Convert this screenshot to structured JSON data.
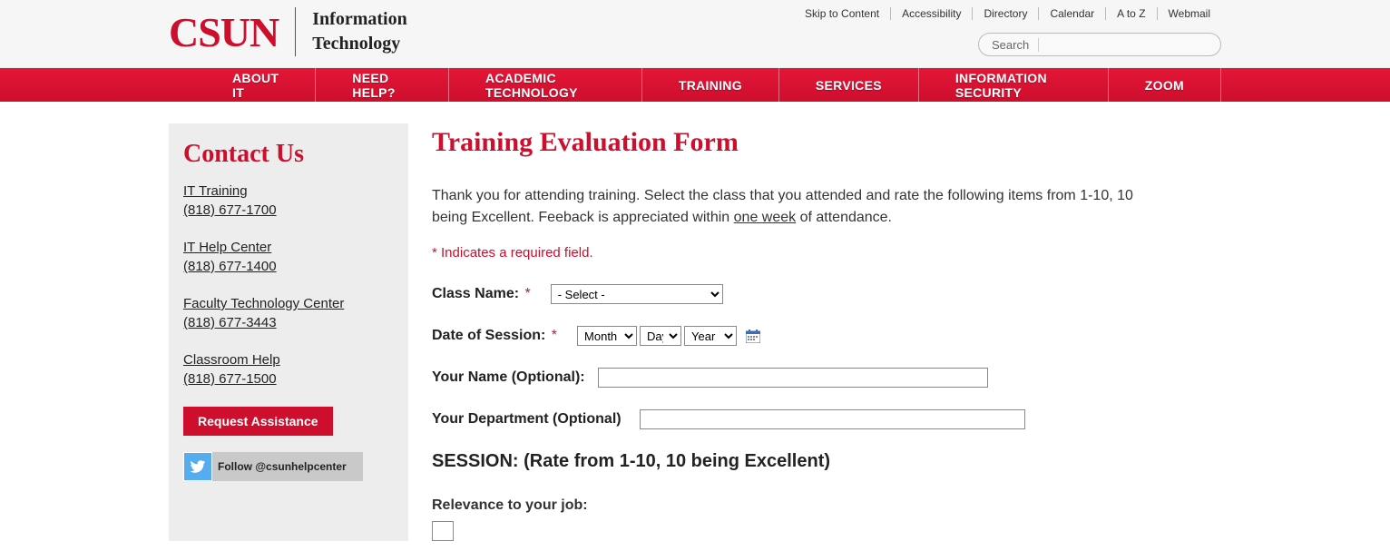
{
  "header": {
    "logo_text": "CSUN",
    "site_title_line1": "Information",
    "site_title_line2": "Technology",
    "util_links": [
      "Skip to Content",
      "Accessibility",
      "Directory",
      "Calendar",
      "A to Z",
      "Webmail"
    ],
    "search_label": "Search"
  },
  "nav": {
    "items": [
      "ABOUT IT",
      "NEED HELP?",
      "ACADEMIC TECHNOLOGY",
      "TRAINING",
      "SERVICES",
      "INFORMATION SECURITY",
      "ZOOM"
    ]
  },
  "sidebar": {
    "title": "Contact Us",
    "contacts": [
      {
        "name": "IT Training",
        "phone": "(818) 677-1700"
      },
      {
        "name": "IT Help Center",
        "phone": "(818) 677-1400"
      },
      {
        "name": "Faculty Technology Center",
        "phone": "(818) 677-3443"
      },
      {
        "name": "Classroom Help",
        "phone": "(818) 677-1500"
      }
    ],
    "request_label": "Request Assistance",
    "twitter_label": "Follow @csunhelpcenter"
  },
  "main": {
    "title": "Training Evaluation Form",
    "intro_pre": "Thank you for attending training. Select the class that you attended and rate the following items from 1-10, 10 being Excellent. Feeback is appreciated within ",
    "intro_underlined": "one week",
    "intro_post": " of attendance.",
    "required_note": "* Indicates a required field.",
    "labels": {
      "class_name": "Class Name:",
      "date_of_session": "Date of Session:",
      "your_name": "Your Name (Optional):",
      "your_department": "Your Department (Optional)"
    },
    "class_select_placeholder": "- Select -",
    "month_placeholder": "Month",
    "day_placeholder": "Day",
    "year_placeholder": "Year",
    "session_heading": "SESSION: (Rate from 1-10, 10 being Excellent)",
    "rating1_label": "Relevance to your job:"
  }
}
